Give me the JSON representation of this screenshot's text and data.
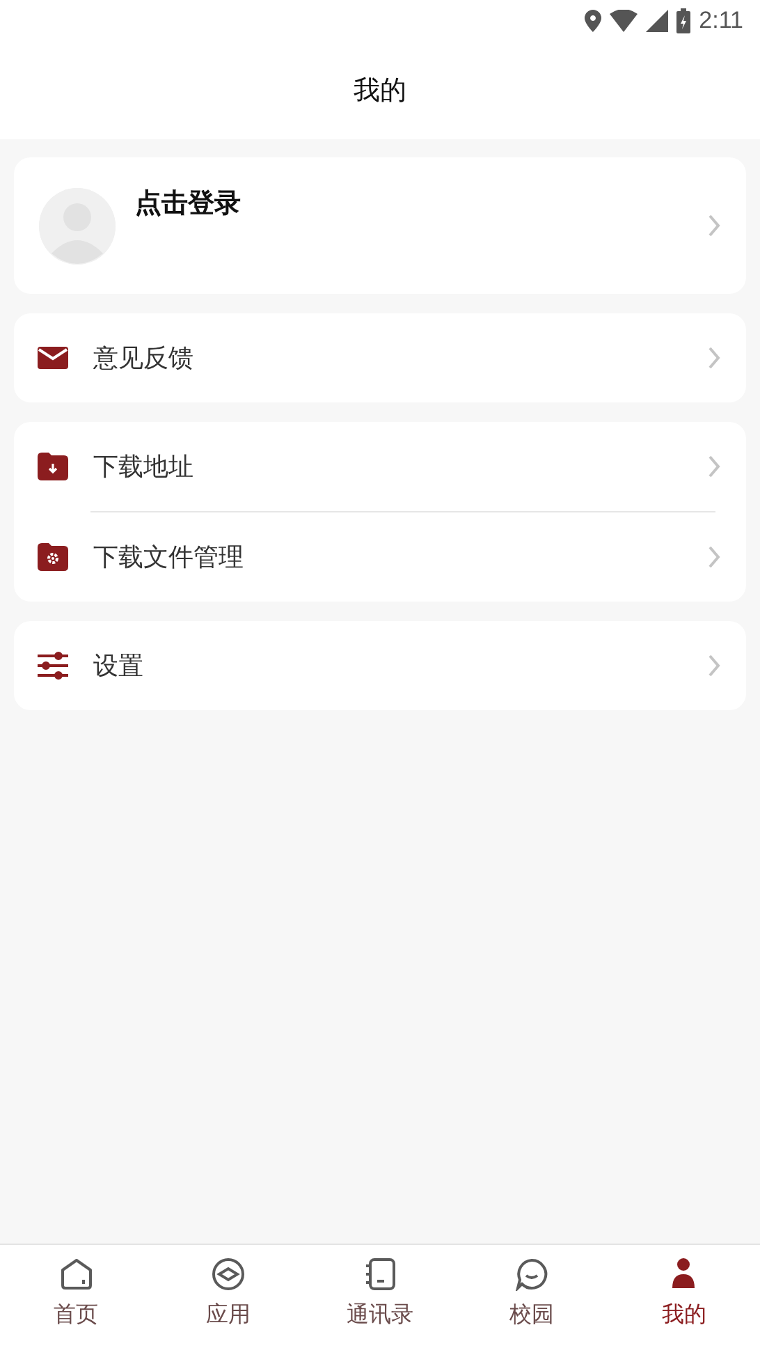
{
  "status_bar": {
    "time": "2:11"
  },
  "header": {
    "title": "我的"
  },
  "profile": {
    "login_text": "点击登录"
  },
  "menu_groups": [
    {
      "items": [
        {
          "label": "意见反馈",
          "kind": "mail"
        }
      ]
    },
    {
      "items": [
        {
          "label": "下载地址",
          "kind": "folder-download"
        },
        {
          "label": "下载文件管理",
          "kind": "folder-gear"
        }
      ]
    },
    {
      "items": [
        {
          "label": "设置",
          "kind": "sliders"
        }
      ]
    }
  ],
  "tabs": [
    {
      "label": "首页",
      "kind": "home",
      "selected": false
    },
    {
      "label": "应用",
      "kind": "apps",
      "selected": false
    },
    {
      "label": "通讯录",
      "kind": "contacts",
      "selected": false
    },
    {
      "label": "校园",
      "kind": "chat",
      "selected": false
    },
    {
      "label": "我的",
      "kind": "me",
      "selected": true
    }
  ]
}
